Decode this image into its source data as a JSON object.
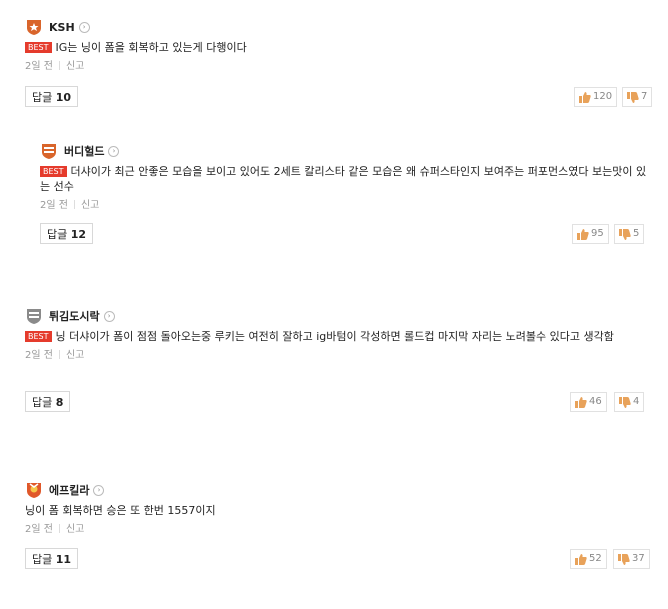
{
  "comments": [
    {
      "nickname": "KSH",
      "best_label": "BEST",
      "is_best": true,
      "text": "IG는 닝이 폼을 회복하고 있는게 다행이다",
      "time": "2일 전",
      "report": "신고",
      "reply_label": "답글",
      "reply_count": "10",
      "likes": "120",
      "dislikes": "7",
      "badge_color": "#d9652b"
    },
    {
      "nickname": "버디헐드",
      "best_label": "BEST",
      "is_best": true,
      "text": "더샤이가 최근 안좋은 모습을 보이고 있어도 2세트 칼리스타 같은 모습은 왜 슈퍼스타인지 보여주는 퍼포먼스였다 보는맛이 있는 선수",
      "time": "2일 전",
      "report": "신고",
      "reply_label": "답글",
      "reply_count": "12",
      "likes": "95",
      "dislikes": "5",
      "badge_color": "#d9652b"
    },
    {
      "nickname": "튀김도시락",
      "best_label": "BEST",
      "is_best": true,
      "text": "닝 더샤이가 폼이 점점 돌아오는중 루키는 여전히 잘하고 ig바텀이 각성하면 롤드컵 마지막 자리는 노려볼수 있다고 생각함",
      "time": "2일 전",
      "report": "신고",
      "reply_label": "답글",
      "reply_count": "8",
      "likes": "46",
      "dislikes": "4",
      "badge_color": "#8a8a8a"
    },
    {
      "nickname": "에프킬라",
      "is_best": false,
      "text": "닝이 폼 회복하면 승은 또 한번 1557이지",
      "time": "2일 전",
      "report": "신고",
      "reply_label": "답글",
      "reply_count": "11",
      "likes": "52",
      "dislikes": "37",
      "badge_color": "#e0582a"
    }
  ]
}
